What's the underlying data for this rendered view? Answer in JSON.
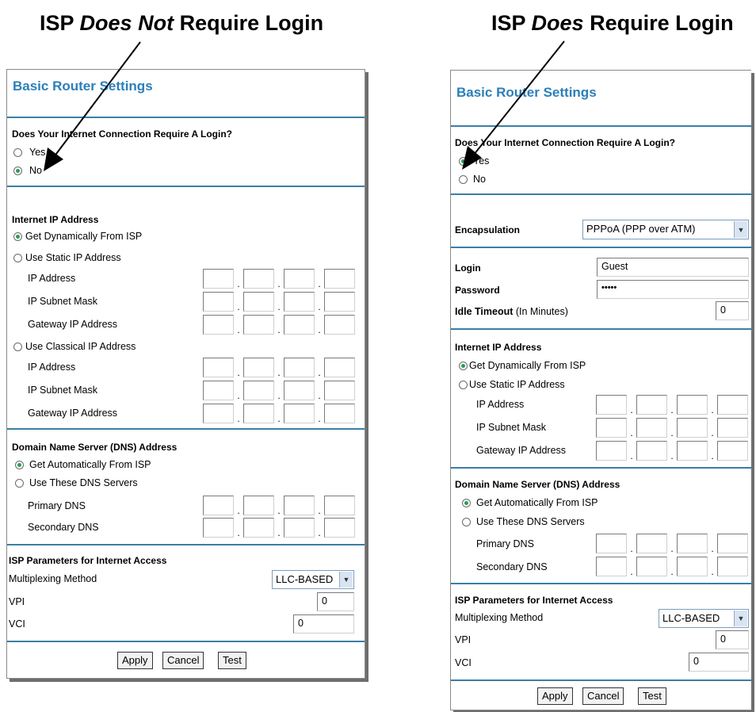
{
  "captions": {
    "left_prefix": "ISP ",
    "left_emph": "Does Not",
    "left_suffix": " Require Login",
    "right_prefix": "ISP ",
    "right_emph": "Does",
    "right_suffix": " Require Login"
  },
  "left": {
    "title": "Basic Router Settings",
    "login_question": "Does Your Internet Connection Require A Login?",
    "login_yes": "Yes",
    "login_no": "No",
    "login_selected": "No",
    "ip_section": "Internet IP Address",
    "ip_dynamic": "Get Dynamically From ISP",
    "ip_static": "Use Static IP Address",
    "ip_address": "IP Address",
    "ip_subnet": "IP Subnet Mask",
    "ip_gateway": "Gateway IP Address",
    "ip_classical": "Use Classical IP Address",
    "cl_address": "IP Address",
    "cl_subnet": "IP Subnet Mask",
    "cl_gateway": "Gateway IP Address",
    "dns_section": "Domain Name Server (DNS) Address",
    "dns_auto": "Get Automatically From ISP",
    "dns_manual": "Use These DNS Servers",
    "dns_primary": "Primary DNS",
    "dns_secondary": "Secondary DNS",
    "isp_section": "ISP Parameters for Internet Access",
    "mux_label": "Multiplexing Method",
    "mux_value": "LLC-BASED",
    "vpi_label": "VPI",
    "vpi_value": "0",
    "vci_label": "VCI",
    "vci_value": "0",
    "apply": "Apply",
    "cancel": "Cancel",
    "test": "Test"
  },
  "right": {
    "title": "Basic Router Settings",
    "login_question": "Does Your Internet Connection Require A Login?",
    "login_yes": "Yes",
    "login_no": "No",
    "login_selected": "Yes",
    "encap_label": "Encapsulation",
    "encap_value": "PPPoA (PPP over ATM)",
    "login_label": "Login",
    "login_value": "Guest",
    "password_label": "Password",
    "password_value": "•••••",
    "idle_label_bold": "Idle Timeout",
    "idle_label_rest": " (In Minutes)",
    "idle_value": "0",
    "ip_section": "Internet IP Address",
    "ip_dynamic": "Get Dynamically From ISP",
    "ip_static": "Use Static IP Address",
    "ip_address": "IP Address",
    "ip_subnet": "IP Subnet Mask",
    "ip_gateway": "Gateway IP Address",
    "dns_section": "Domain Name Server (DNS) Address",
    "dns_auto": "Get Automatically From ISP",
    "dns_manual": "Use These DNS Servers",
    "dns_primary": "Primary DNS",
    "dns_secondary": "Secondary DNS",
    "isp_section": "ISP Parameters for Internet Access",
    "mux_label": "Multiplexing Method",
    "mux_value": "LLC-BASED",
    "vpi_label": "VPI",
    "vpi_value": "0",
    "vci_label": "VCI",
    "vci_value": "0",
    "apply": "Apply",
    "cancel": "Cancel",
    "test": "Test"
  },
  "icons": {
    "dropdown": "chevron-down-icon",
    "radio_on": "radio-selected-icon",
    "radio_off": "radio-unselected-icon"
  },
  "colors": {
    "title": "#2b7fb9",
    "rule": "#3b7fa6",
    "radio_dot": "#2b9c5a"
  }
}
